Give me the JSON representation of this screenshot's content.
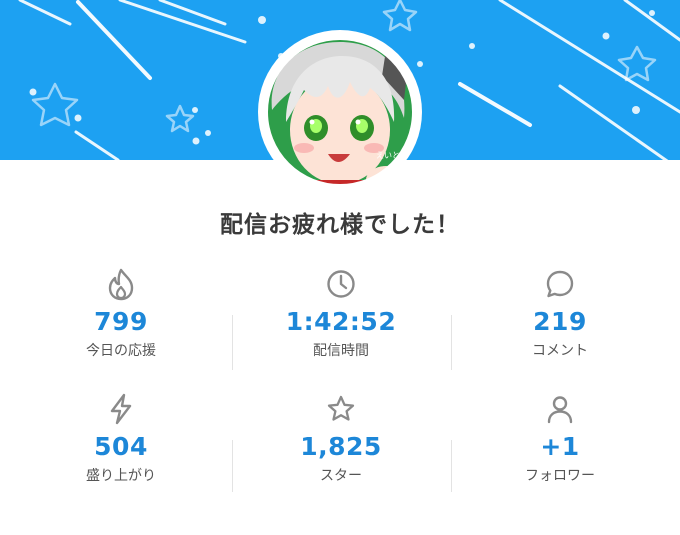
{
  "header": {
    "banner_color": "#1da1f2",
    "avatar_caption": "えいとくん"
  },
  "summary": {
    "title": "配信お疲れ様でした！"
  },
  "stats": [
    {
      "icon": "flame-icon",
      "value": "799",
      "label": "今日の応援"
    },
    {
      "icon": "clock-icon",
      "value": "1:42:52",
      "label": "配信時間"
    },
    {
      "icon": "speech-bubble-icon",
      "value": "219",
      "label": "コメント"
    },
    {
      "icon": "lightning-icon",
      "value": "504",
      "label": "盛り上がり"
    },
    {
      "icon": "star-icon",
      "value": "1,825",
      "label": "スター"
    },
    {
      "icon": "person-icon",
      "value": "+1",
      "label": "フォロワー"
    }
  ],
  "colors": {
    "accent_value": "#1d87d8",
    "icon_gray": "#8a8a8a"
  }
}
